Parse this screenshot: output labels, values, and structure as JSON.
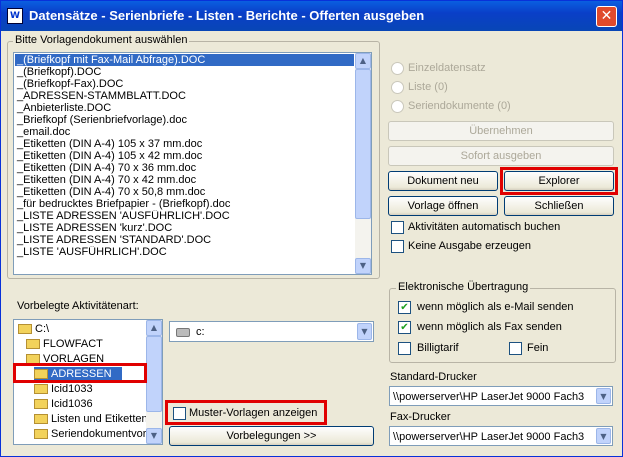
{
  "window": {
    "title": "Datensätze - Serienbriefe - Listen - Berichte - Offerten ausgeben",
    "app_icon": "W",
    "close_label": "✕"
  },
  "templates": {
    "label": "Bitte Vorlagendokument auswählen",
    "items": [
      "_(Briefkopf mit Fax-Mail Abfrage).DOC",
      "_(Briefkopf).DOC",
      "_(Briefkopf-Fax).DOC",
      "_ADRESSEN-STAMMBLATT.DOC",
      "_Anbieterliste.DOC",
      "_Briefkopf (Serienbriefvorlage).doc",
      "_email.doc",
      "_Etiketten (DIN A-4) 105 x 37 mm.doc",
      "_Etiketten (DIN A-4) 105 x 42 mm.doc",
      "_Etiketten (DIN A-4) 70 x 36 mm.doc",
      "_Etiketten (DIN A-4) 70 x 42 mm.doc",
      "_Etiketten (DIN A-4) 70 x 50,8 mm.doc",
      "_für bedrucktes Briefpapier - (Briefkopf).doc",
      "_LISTE ADRESSEN 'AUSFÜHRLICH'.DOC",
      "_LISTE ADRESSEN 'kurz'.DOC",
      "_LISTE ADRESSEN 'STANDARD'.DOC",
      "_LISTE 'AUSFÜHRLICH'.DOC"
    ],
    "selected_index": 0
  },
  "options": {
    "radio_single": "Einzeldatensatz",
    "radio_list": "Liste (0)",
    "radio_serial": "Seriendokumente (0)",
    "apply_button": "Übernehmen",
    "print_now_button": "Sofort ausgeben",
    "new_document_button": "Dokument neu",
    "explorer_button": "Explorer",
    "open_template_button": "Vorlage öffnen",
    "close_button": "Schließen",
    "auto_book_label": "Aktivitäten automatisch buchen",
    "no_output_label": "Keine Ausgabe erzeugen",
    "auto_book_checked": false,
    "no_output_checked": false
  },
  "preset": {
    "label": "Vorbelegte Aktivitätenart:",
    "tree": [
      "C:\\",
      "FLOWFACT",
      "VORLAGEN",
      "ADRESSEN",
      "Icid1033",
      "Icid1036",
      "Listen und Etiketten",
      "Seriendokumentvorla"
    ],
    "selected": "ADRESSEN",
    "drive_value": "c:",
    "show_templates_label": "Muster-Vorlagen anzeigen",
    "show_templates_checked": false,
    "presets_button": "Vorbelegungen >>"
  },
  "electronic": {
    "label": "Elektronische Übertragung",
    "email_label": "wenn möglich als e-Mail senden",
    "email_checked": true,
    "fax_label": "wenn möglich als Fax senden",
    "fax_checked": true,
    "cheap_label": "Billigtarif",
    "cheap_checked": false,
    "fine_label": "Fein",
    "fine_checked": false
  },
  "printers": {
    "standard_label": "Standard-Drucker",
    "standard_value": "\\\\powerserver\\HP LaserJet 9000 Fach3",
    "fax_label": "Fax-Drucker",
    "fax_value": "\\\\powerserver\\HP LaserJet 9000 Fach3"
  },
  "icons": {
    "scroll_up": "▲",
    "scroll_down": "▼",
    "dropdown": "▼",
    "check": "✔"
  },
  "colors": {
    "titlebar": "#0a3fc8",
    "selection": "#316ac5",
    "highlight_box": "#e00000",
    "dialog_bg": "#ece9d8"
  }
}
